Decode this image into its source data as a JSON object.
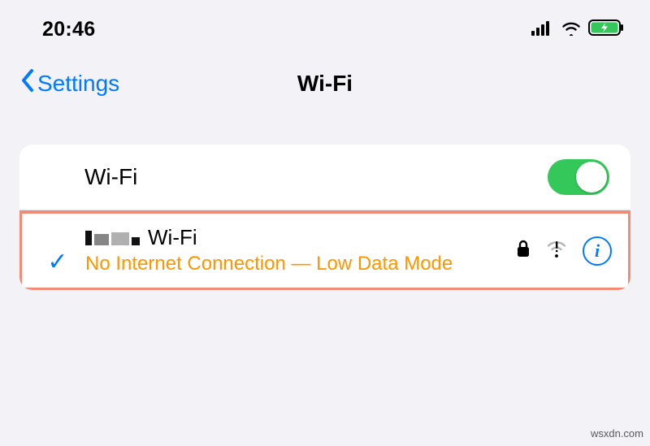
{
  "statusBar": {
    "time": "20:46"
  },
  "nav": {
    "back": "Settings",
    "title": "Wi-Fi"
  },
  "wifi": {
    "label": "Wi-Fi",
    "enabled": true
  },
  "network": {
    "nameSuffix": "Wi-Fi",
    "status": "No Internet Connection — Low Data Mode",
    "connected": true
  },
  "watermark": "wsxdn.com"
}
